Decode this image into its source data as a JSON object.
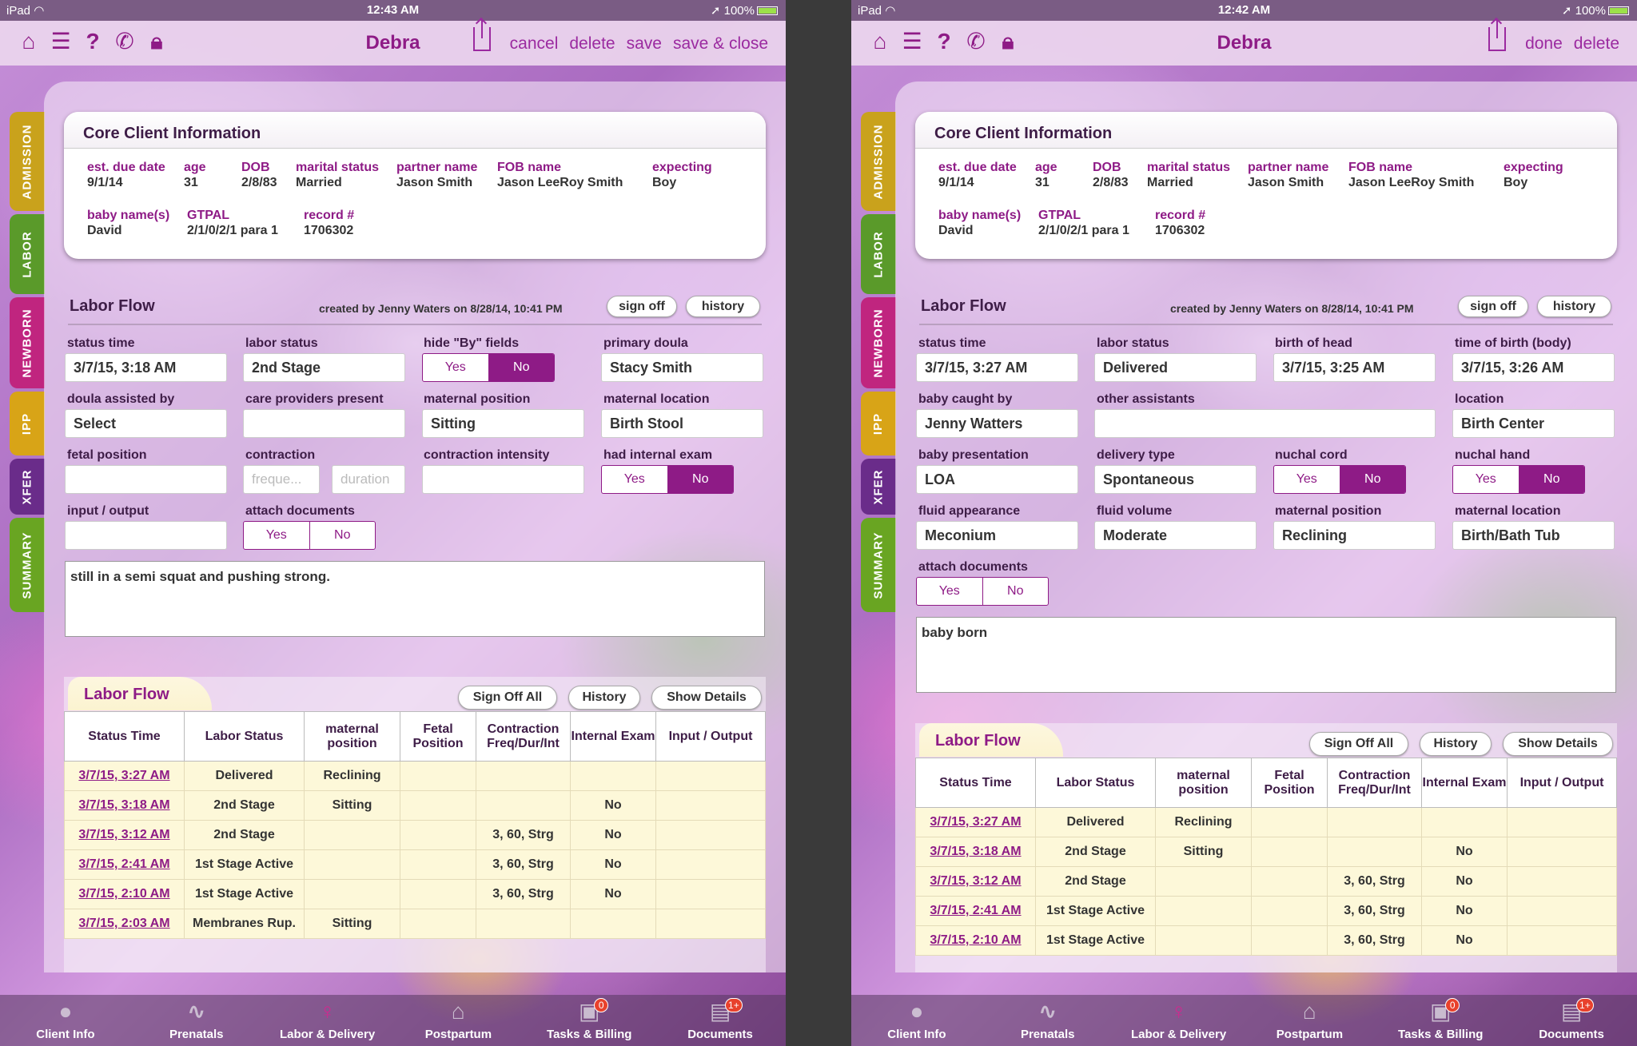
{
  "statusbar": {
    "left": "iPad",
    "time_left": "12:43 AM",
    "time_right": "12:42 AM",
    "battery": "100%"
  },
  "nav": {
    "title": "Debra",
    "left_actions": [
      "cancel",
      "delete",
      "save",
      "save & close"
    ],
    "right_actions": [
      "done",
      "delete"
    ],
    "icons": [
      "home-icon",
      "list-icon",
      "help-icon",
      "phone-icon",
      "lock-icon",
      "share-icon"
    ]
  },
  "sidetabs": [
    {
      "label": "ADMISSION",
      "color": "#c9a21c"
    },
    {
      "label": "LABOR",
      "color": "#5a9a2a"
    },
    {
      "label": "NEWBORN",
      "color": "#c0257f"
    },
    {
      "label": "IPP",
      "color": "#d8a417"
    },
    {
      "label": "XFER",
      "color": "#6a2c8a"
    },
    {
      "label": "SUMMARY",
      "color": "#69a522"
    }
  ],
  "core": {
    "title": "Core Client Information",
    "row1": [
      {
        "k": "est. due date",
        "v": "9/1/14"
      },
      {
        "k": "age",
        "v": "31"
      },
      {
        "k": "DOB",
        "v": "2/8/83"
      },
      {
        "k": "marital status",
        "v": "Married"
      },
      {
        "k": "partner name",
        "v": "Jason Smith"
      },
      {
        "k": "FOB name",
        "v": "Jason LeeRoy Smith"
      },
      {
        "k": "expecting",
        "v": "Boy"
      }
    ],
    "row2": [
      {
        "k": "baby name(s)",
        "v": "David"
      },
      {
        "k": "GTPAL",
        "v": "2/1/0/2/1 para 1"
      },
      {
        "k": "record #",
        "v": "1706302"
      }
    ]
  },
  "flow": {
    "title": "Labor Flow",
    "created": "created by Jenny Waters on 8/28/14, 10:41 PM",
    "sign_off": "sign off",
    "history": "history"
  },
  "left_form": {
    "status_time": {
      "label": "status time",
      "value": "3/7/15, 3:18 AM"
    },
    "labor_status": {
      "label": "labor status",
      "value": "2nd Stage"
    },
    "hide_by": {
      "label": "hide \"By\" fields",
      "yes": "Yes",
      "no": "No"
    },
    "primary_doula": {
      "label": "primary doula",
      "value": "Stacy Smith"
    },
    "doula_assisted": {
      "label": "doula assisted by",
      "value": "Select"
    },
    "care_providers": {
      "label": "care providers present",
      "value": ""
    },
    "maternal_position": {
      "label": "maternal position",
      "value": "Sitting"
    },
    "maternal_location": {
      "label": "maternal location",
      "value": "Birth Stool"
    },
    "fetal_position": {
      "label": "fetal position",
      "value": ""
    },
    "contraction": {
      "label": "contraction",
      "freq_ph": "freque...",
      "dur_ph": "duration"
    },
    "contraction_intensity": {
      "label": "contraction intensity",
      "value": ""
    },
    "internal_exam": {
      "label": "had internal exam",
      "yes": "Yes",
      "no": "No"
    },
    "input_output": {
      "label": "input / output",
      "value": ""
    },
    "attach": {
      "label": "attach documents",
      "yes": "Yes",
      "no": "No"
    },
    "notes": "still in a semi squat and pushing strong."
  },
  "right_form": {
    "status_time": {
      "label": "status time",
      "value": "3/7/15, 3:27 AM"
    },
    "labor_status": {
      "label": "labor status",
      "value": "Delivered"
    },
    "birth_head": {
      "label": "birth of head",
      "value": "3/7/15, 3:25 AM"
    },
    "birth_body": {
      "label": "time of birth (body)",
      "value": "3/7/15, 3:26 AM"
    },
    "caught_by": {
      "label": "baby caught by",
      "value": "Jenny Watters"
    },
    "other_assist": {
      "label": "other assistants",
      "value": ""
    },
    "location": {
      "label": "location",
      "value": "Birth Center"
    },
    "presentation": {
      "label": "baby presentation",
      "value": "LOA"
    },
    "delivery_type": {
      "label": "delivery type",
      "value": "Spontaneous"
    },
    "nuchal_cord": {
      "label": "nuchal cord",
      "yes": "Yes",
      "no": "No"
    },
    "nuchal_hand": {
      "label": "nuchal hand",
      "yes": "Yes",
      "no": "No"
    },
    "fluid_appearance": {
      "label": "fluid appearance",
      "value": "Meconium"
    },
    "fluid_volume": {
      "label": "fluid volume",
      "value": "Moderate"
    },
    "maternal_position": {
      "label": "maternal position",
      "value": "Reclining"
    },
    "maternal_location": {
      "label": "maternal location",
      "value": "Birth/Bath Tub"
    },
    "attach": {
      "label": "attach documents",
      "yes": "Yes",
      "no": "No"
    },
    "notes": "baby born"
  },
  "lf_table": {
    "title": "Labor Flow",
    "sign_off_all": "Sign Off All",
    "history": "History",
    "show_details": "Show Details",
    "headers": [
      "Status Time",
      "Labor Status",
      "maternal position",
      "Fetal Position",
      "Contraction Freq/Dur/Int",
      "Internal Exam",
      "Input / Output"
    ],
    "rows": [
      [
        "3/7/15, 3:27 AM",
        "Delivered",
        "Reclining",
        "",
        "",
        "",
        ""
      ],
      [
        "3/7/15, 3:18 AM",
        "2nd Stage",
        "Sitting",
        "",
        "",
        "No",
        ""
      ],
      [
        "3/7/15, 3:12 AM",
        "2nd Stage",
        "",
        "",
        "3, 60, Strg",
        "No",
        ""
      ],
      [
        "3/7/15, 2:41 AM",
        "1st Stage Active",
        "",
        "",
        "3, 60, Strg",
        "No",
        ""
      ],
      [
        "3/7/15, 2:10 AM",
        "1st Stage Active",
        "",
        "",
        "3, 60, Strg",
        "No",
        ""
      ],
      [
        "3/7/15, 2:03 AM",
        "Membranes Rup.",
        "Sitting",
        "",
        "",
        "",
        ""
      ]
    ]
  },
  "tabbar": [
    {
      "label": "Client Info",
      "icon": "person-icon"
    },
    {
      "label": "Prenatals",
      "icon": "heartbeat-icon"
    },
    {
      "label": "Labor & Delivery",
      "icon": "mother-icon"
    },
    {
      "label": "Postpartum",
      "icon": "house-icon"
    },
    {
      "label": "Tasks & Billing",
      "icon": "inbox-icon",
      "badge": "0"
    },
    {
      "label": "Documents",
      "icon": "files-icon",
      "badge": "1+"
    }
  ]
}
